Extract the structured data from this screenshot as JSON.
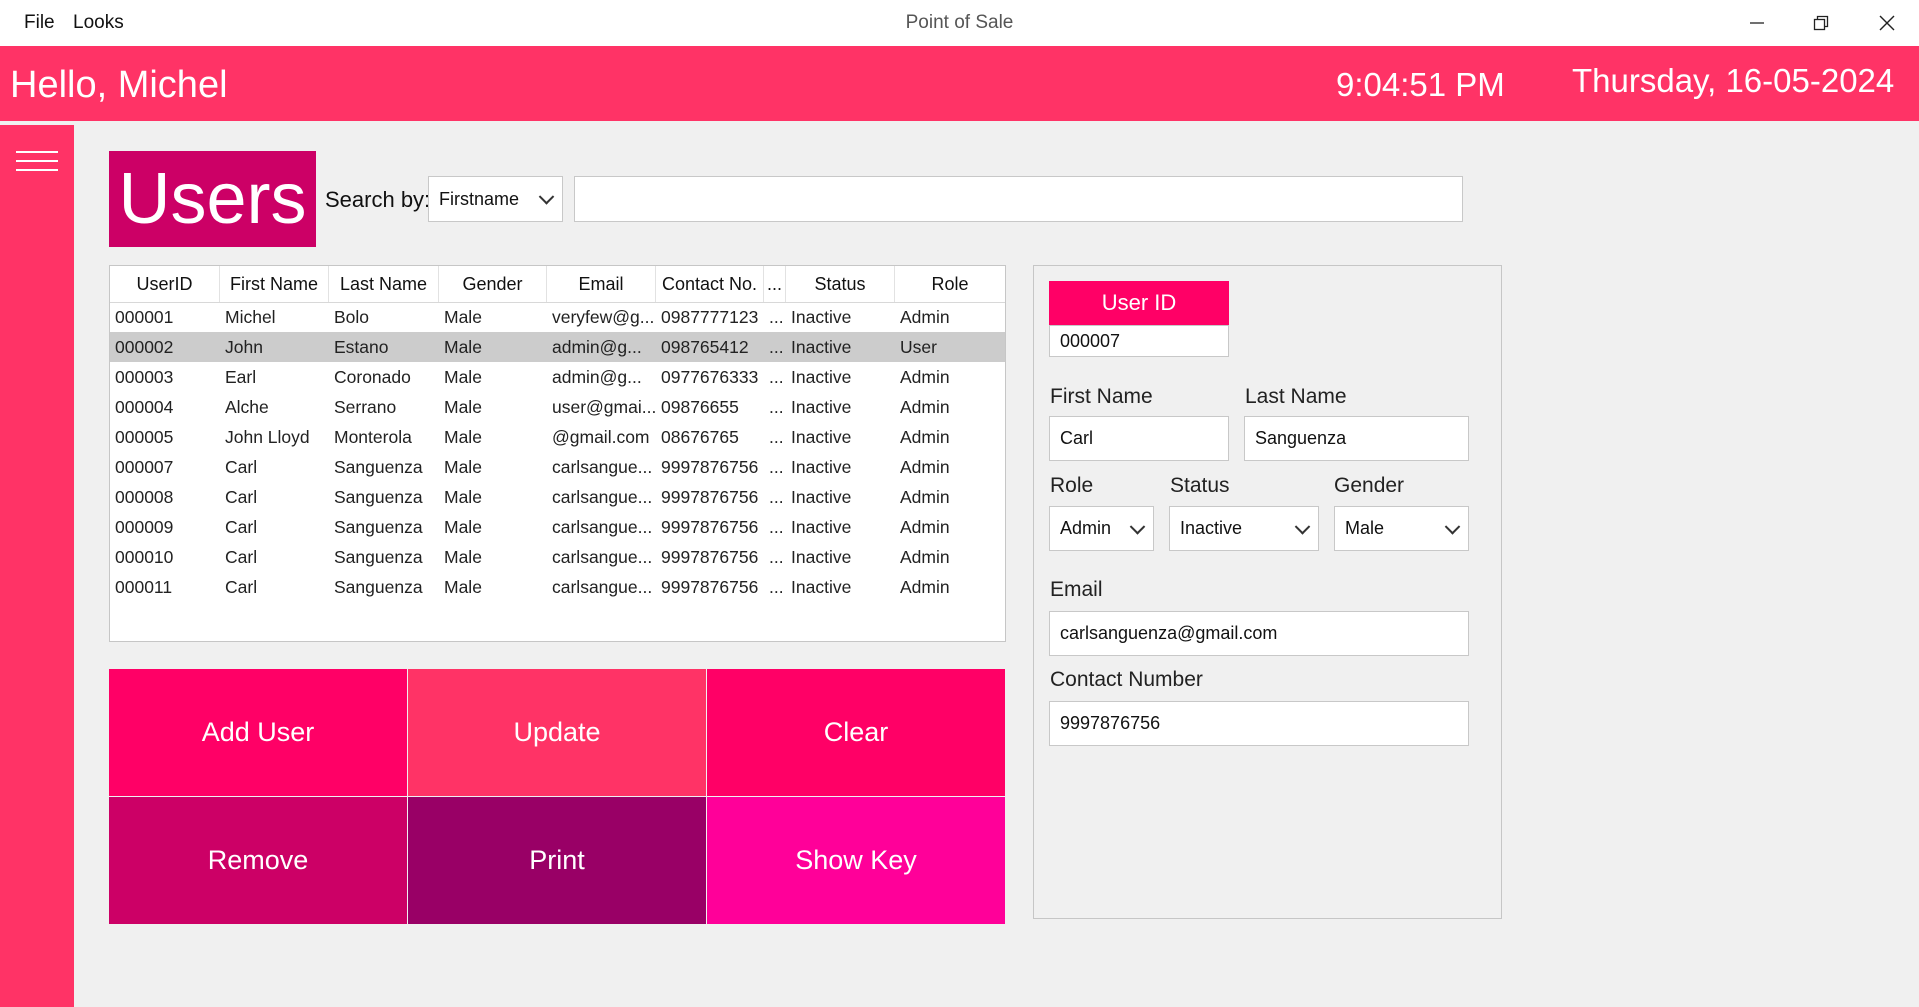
{
  "window": {
    "title": "Point of Sale",
    "menu": [
      "File",
      "Looks"
    ]
  },
  "header": {
    "greeting": "Hello,  Michel",
    "time": "9:04:51 PM",
    "date": "Thursday, 16-05-2024"
  },
  "page": {
    "title": "Users"
  },
  "search": {
    "label": "Search by:",
    "field": "Firstname",
    "query": ""
  },
  "grid": {
    "columns": [
      "UserID",
      "First Name",
      "Last Name",
      "Gender",
      "Email",
      "Contact No.",
      "...",
      "Status",
      "Role"
    ],
    "rows": [
      [
        "000001",
        "Michel",
        "Bolo",
        "Male",
        "veryfew@g...",
        "0987777123",
        "...",
        "Inactive",
        "Admin"
      ],
      [
        "000002",
        "John",
        "Estano",
        "Male",
        "admin@g...",
        "098765412",
        "...",
        "Inactive",
        "User"
      ],
      [
        "000003",
        "Earl",
        "Coronado",
        "Male",
        "admin@g...",
        "0977676333",
        "...",
        "Inactive",
        "Admin"
      ],
      [
        "000004",
        "Alche",
        "Serrano",
        "Male",
        "user@gmai...",
        "09876655",
        "...",
        "Inactive",
        "Admin"
      ],
      [
        "000005",
        "John Lloyd",
        "Monterola",
        "Male",
        "@gmail.com",
        "08676765",
        "...",
        "Inactive",
        "Admin"
      ],
      [
        "000007",
        "Carl",
        "Sanguenza",
        "Male",
        "carlsangue...",
        "9997876756",
        "...",
        "Inactive",
        "Admin"
      ],
      [
        "000008",
        "Carl",
        "Sanguenza",
        "Male",
        "carlsangue...",
        "9997876756",
        "...",
        "Inactive",
        "Admin"
      ],
      [
        "000009",
        "Carl",
        "Sanguenza",
        "Male",
        "carlsangue...",
        "9997876756",
        "...",
        "Inactive",
        "Admin"
      ],
      [
        "000010",
        "Carl",
        "Sanguenza",
        "Male",
        "carlsangue...",
        "9997876756",
        "...",
        "Inactive",
        "Admin"
      ],
      [
        "000011",
        "Carl",
        "Sanguenza",
        "Male",
        "carlsangue...",
        "9997876756",
        "...",
        "Inactive",
        "Admin"
      ]
    ],
    "selected_row": 1
  },
  "actions": [
    {
      "label": "Add User",
      "color": "#ff0066"
    },
    {
      "label": "Update",
      "color": "#ff3366"
    },
    {
      "label": "Clear",
      "color": "#ff0066"
    },
    {
      "label": "Remove",
      "color": "#cc0066"
    },
    {
      "label": "Print",
      "color": "#990066"
    },
    {
      "label": "Show Key",
      "color": "#ff0099"
    }
  ],
  "form": {
    "user_id_label": "User ID",
    "user_id": "000007",
    "first_name_label": "First Name",
    "first_name": "Carl",
    "last_name_label": "Last Name",
    "last_name": "Sanguenza",
    "role_label": "Role",
    "role": "Admin",
    "status_label": "Status",
    "status": "Inactive",
    "gender_label": "Gender",
    "gender": "Male",
    "email_label": "Email",
    "email": "carlsanguenza@gmail.com",
    "contact_label": "Contact Number",
    "contact": "9997876756"
  },
  "colors": {
    "accent": "#ff3366",
    "title_block": "#cc0066",
    "user_id_label": "#ff0066",
    "selected_row": "#cccccc"
  }
}
